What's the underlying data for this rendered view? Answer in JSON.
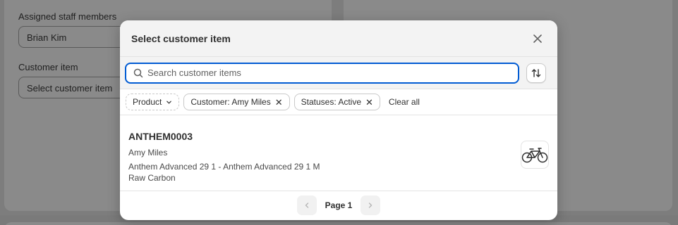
{
  "background": {
    "assigned_label": "Assigned staff members",
    "assigned_value": "Brian Kim",
    "customer_item_label": "Customer item",
    "customer_item_placeholder": "Select customer item"
  },
  "modal": {
    "title": "Select customer item",
    "search_placeholder": "Search customer items",
    "filters": [
      {
        "label": "Product",
        "type": "dropdown"
      },
      {
        "label": "Customer: Amy Miles",
        "type": "removable"
      },
      {
        "label": "Statuses: Active",
        "type": "removable"
      }
    ],
    "clear_all": "Clear all",
    "results": [
      {
        "id": "ANTHEM0003",
        "customer": "Amy Miles",
        "product": "Anthem Advanced 29 1 - Anthem Advanced 29 1 M",
        "variant": "Raw Carbon",
        "thumbnail_icon": "bicycle-icon"
      }
    ],
    "pagination": {
      "label": "Page 1"
    }
  },
  "colors": {
    "focus": "#005bd3",
    "overlay": "#7d7d7d"
  }
}
